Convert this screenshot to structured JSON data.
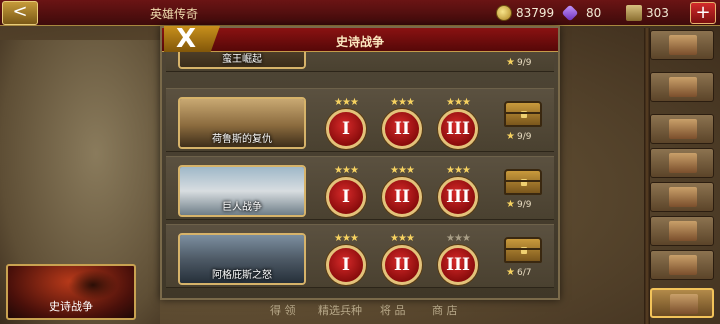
{
  "topbar": {
    "back_label": "<",
    "title": "英雄传奇",
    "coins": "83799",
    "gems": "80",
    "food": "303",
    "add_label": "+"
  },
  "panel": {
    "close_label": "X",
    "title": "史诗战争",
    "partial_row": {
      "caption": "蛮王崛起",
      "progress": "9/9"
    },
    "rows": [
      {
        "caption": "荷鲁斯的复仇",
        "medals": [
          "I",
          "II",
          "III"
        ],
        "progress": "9/9"
      },
      {
        "caption": "巨人战争",
        "medals": [
          "I",
          "II",
          "III"
        ],
        "progress": "9/9"
      },
      {
        "caption": "阿格庇斯之怒",
        "medals": [
          "I",
          "II",
          "III"
        ],
        "progress": "6/7"
      }
    ]
  },
  "epic_banner": {
    "label": "史诗战争"
  },
  "bottom_tabs": [
    "得  领",
    "精选兵种",
    "将  品",
    "商  店"
  ],
  "colors": {
    "header_red": "#6b1414",
    "medal_red": "#b81818",
    "gold": "#d6b36a"
  }
}
